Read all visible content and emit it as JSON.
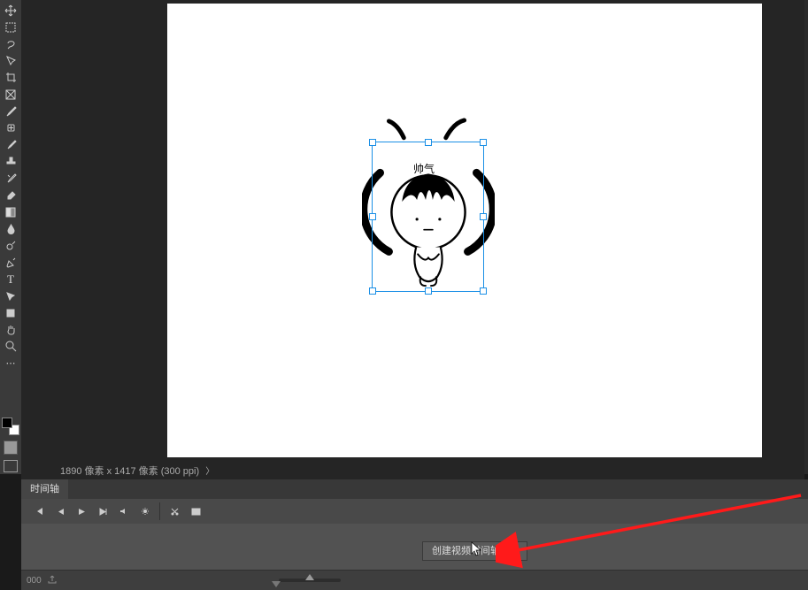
{
  "canvas": {
    "label_text": "帅气"
  },
  "status": {
    "dimensions": "1890 像素 x 1417 像素 (300 ppi)",
    "arrow": "〉"
  },
  "timeline": {
    "tab_label": "时间轴",
    "create_button": "创建视频时间轴",
    "footer_left": "000"
  },
  "tools": [
    {
      "name": "move-tool-icon"
    },
    {
      "name": "rect-marquee-tool-icon"
    },
    {
      "name": "lasso-tool-icon"
    },
    {
      "name": "quick-select-tool-icon"
    },
    {
      "name": "crop-tool-icon"
    },
    {
      "name": "frame-tool-icon"
    },
    {
      "name": "eyedropper-tool-icon"
    },
    {
      "name": "heal-brush-tool-icon"
    },
    {
      "name": "brush-tool-icon"
    },
    {
      "name": "stamp-tool-icon"
    },
    {
      "name": "history-brush-tool-icon"
    },
    {
      "name": "eraser-tool-icon"
    },
    {
      "name": "gradient-tool-icon"
    },
    {
      "name": "blur-tool-icon"
    },
    {
      "name": "dodge-tool-icon"
    },
    {
      "name": "pen-tool-icon"
    },
    {
      "name": "type-tool-icon"
    },
    {
      "name": "path-select-tool-icon"
    },
    {
      "name": "shape-tool-icon"
    },
    {
      "name": "hand-tool-icon"
    },
    {
      "name": "zoom-tool-icon"
    },
    {
      "name": "edit-toolbar-icon"
    }
  ],
  "playback": [
    {
      "name": "go-to-first-frame-icon"
    },
    {
      "name": "prev-frame-icon"
    },
    {
      "name": "play-icon"
    },
    {
      "name": "next-frame-icon"
    },
    {
      "name": "audio-mute-icon"
    },
    {
      "name": "settings-gear-icon"
    }
  ],
  "playback_extra": [
    {
      "name": "split-clip-icon"
    },
    {
      "name": "transition-icon"
    }
  ]
}
